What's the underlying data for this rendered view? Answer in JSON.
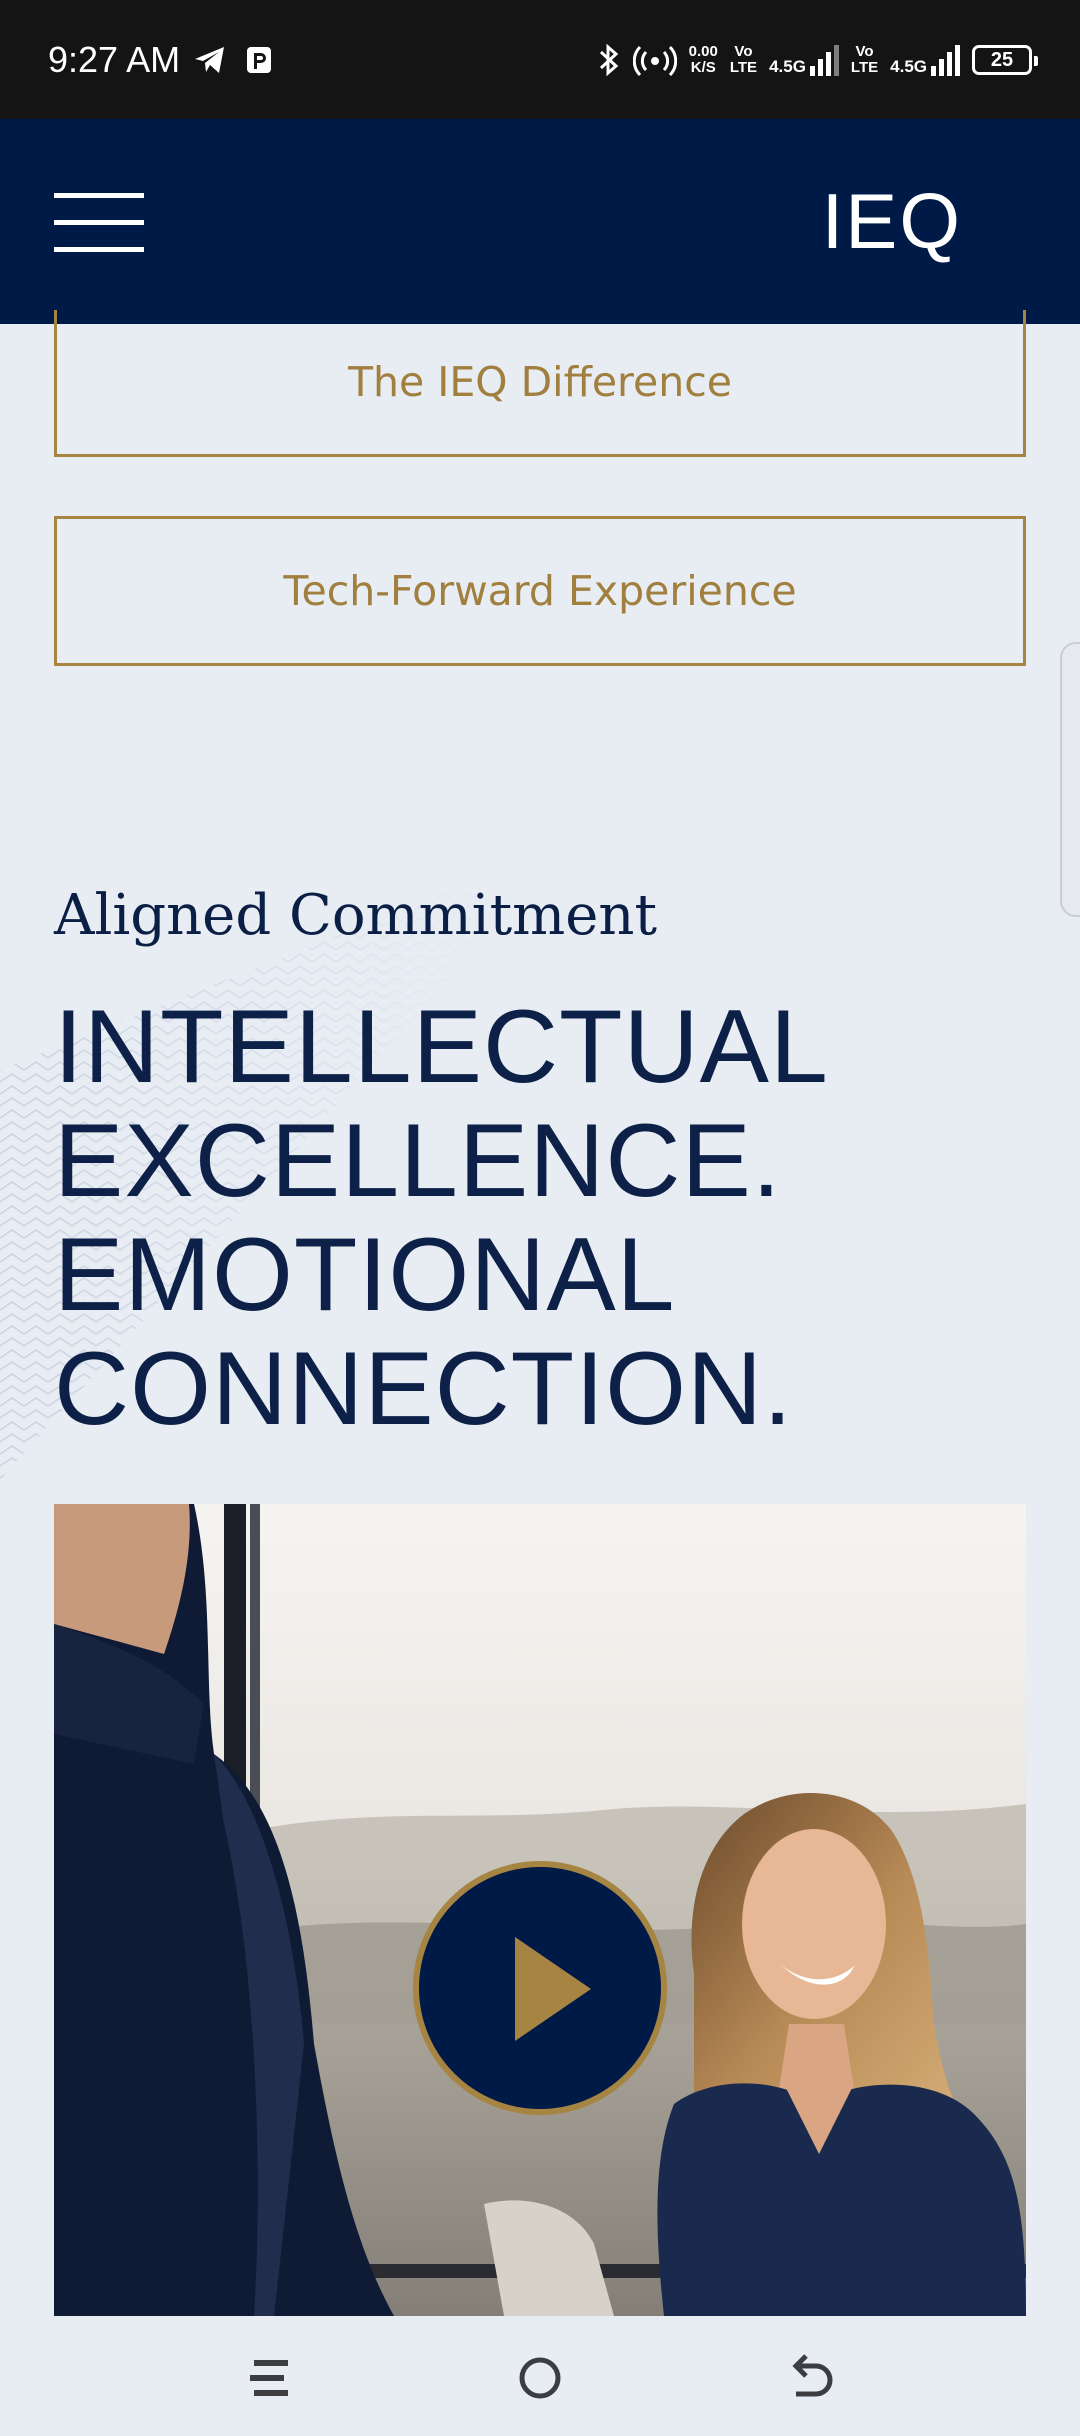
{
  "status_bar": {
    "time": "9:27 AM",
    "net_speed_value": "0.00",
    "net_speed_unit": "K/S",
    "sim1_volte_top": "Vo",
    "sim1_volte_bottom": "LTE",
    "sim1_network": "4.5G",
    "sim2_volte_top": "Vo",
    "sim2_volte_bottom": "LTE",
    "sim2_network": "4.5G",
    "battery_level": "25",
    "icons": [
      "telegram-icon",
      "parking-icon",
      "bluetooth-icon",
      "hotspot-icon"
    ]
  },
  "header": {
    "logo": "IEQ",
    "menu_icon": "hamburger-icon",
    "background_color": "#001a47"
  },
  "buttons": {
    "ieq_difference": "The IEQ Difference",
    "tech_forward": "Tech-Forward Experience"
  },
  "section": {
    "eyebrow": "Aligned Commitment",
    "headline": [
      "INTELLECTUAL",
      "EXCELLENCE.",
      "EMOTIONAL",
      "CONNECTION."
    ]
  },
  "video": {
    "play_icon": "play-icon",
    "accent_color": "#a68441"
  },
  "nav_bar": {
    "icons": [
      "menu-icon",
      "home-icon",
      "back-icon"
    ]
  },
  "colors": {
    "navy": "#001a47",
    "gold": "#a68441",
    "page_background": "#e8edf4"
  }
}
